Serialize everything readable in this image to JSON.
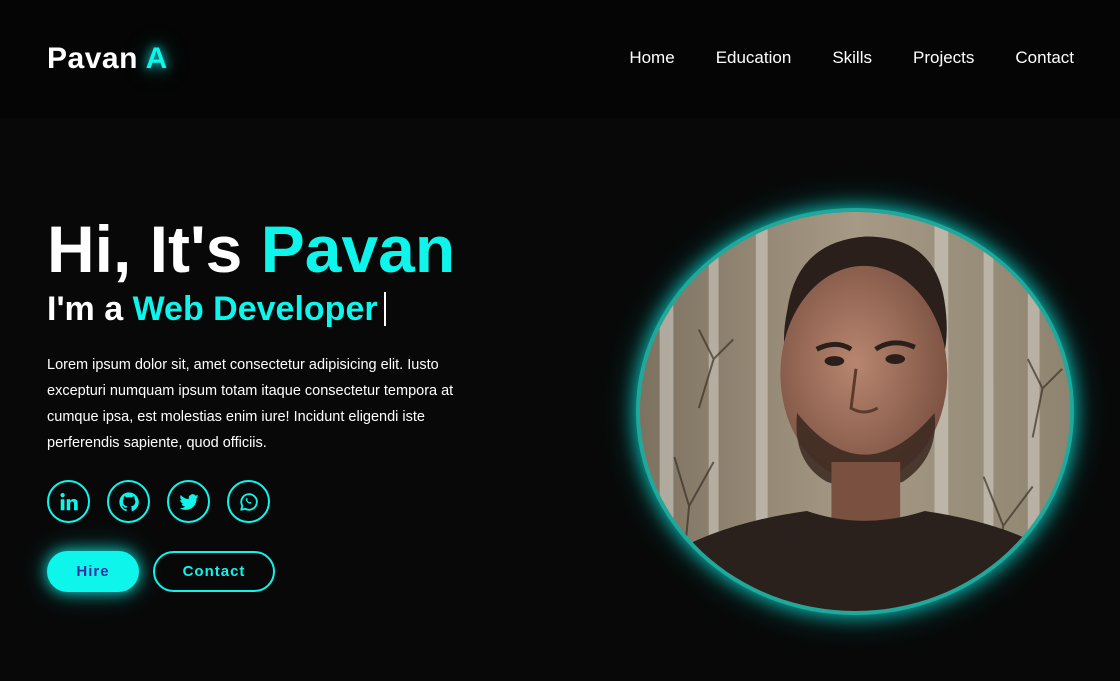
{
  "header": {
    "logo_name": "Pavan",
    "logo_accent": "A",
    "nav": [
      {
        "label": "Home"
      },
      {
        "label": "Education"
      },
      {
        "label": "Skills"
      },
      {
        "label": "Projects"
      },
      {
        "label": "Contact"
      }
    ]
  },
  "hero": {
    "greeting": "Hi, It's",
    "name": "Pavan",
    "role_prefix": "I'm a",
    "role": "Web Developer",
    "description": "Lorem ipsum dolor sit, amet consectetur adipisicing elit. Iusto excepturi numquam ipsum totam itaque consectetur tempora at cumque ipsa, est molestias enim iure! Incidunt eligendi iste perferendis sapiente, quod officiis.",
    "socials": [
      {
        "icon": "linkedin-icon"
      },
      {
        "icon": "github-icon"
      },
      {
        "icon": "twitter-icon"
      },
      {
        "icon": "whatsapp-icon"
      }
    ],
    "hire_label": "Hire",
    "contact_label": "Contact"
  },
  "colors": {
    "accent": "#0ef5ec",
    "background": "#080808",
    "header_background": "#050505",
    "hire_text": "#3a2fa0"
  }
}
